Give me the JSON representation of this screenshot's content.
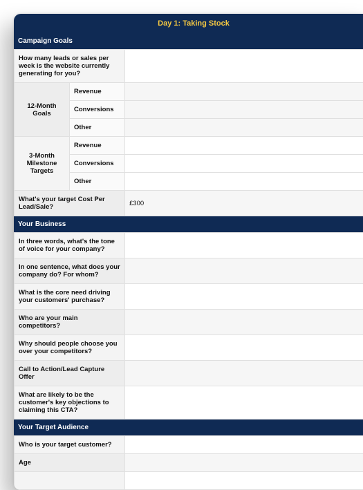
{
  "title": "Day 1: Taking Stock",
  "sections": {
    "campaign_goals": {
      "header": "Campaign Goals",
      "q_leads": "How many leads or sales per week is the website currently generating for you?",
      "goals12_label": "12-Month Goals",
      "milestone3_label": "3-Month Milestone Targets",
      "sub_revenue": "Revenue",
      "sub_conversions": "Conversions",
      "sub_other": "Other",
      "q_target_cost": "What's your target Cost Per Lead/Sale?",
      "v_target_cost": "£300"
    },
    "your_business": {
      "header": "Your Business",
      "q_tone": "In three words, what's the tone of voice for your company?",
      "q_sentence": "In one sentence, what does your company do? For whom?",
      "q_core_need": "What is the core need driving your customers' purchase?",
      "q_competitors": "Who are your main competitors?",
      "q_why_choose": "Why should people choose you over your competitors?",
      "q_cta": "Call to Action/Lead Capture Offer",
      "q_objections": "What are likely to be the customer's key objections to claiming this CTA?"
    },
    "target_audience": {
      "header": "Your Target Audience",
      "q_who": "Who is your target customer?",
      "q_age": "Age"
    }
  }
}
